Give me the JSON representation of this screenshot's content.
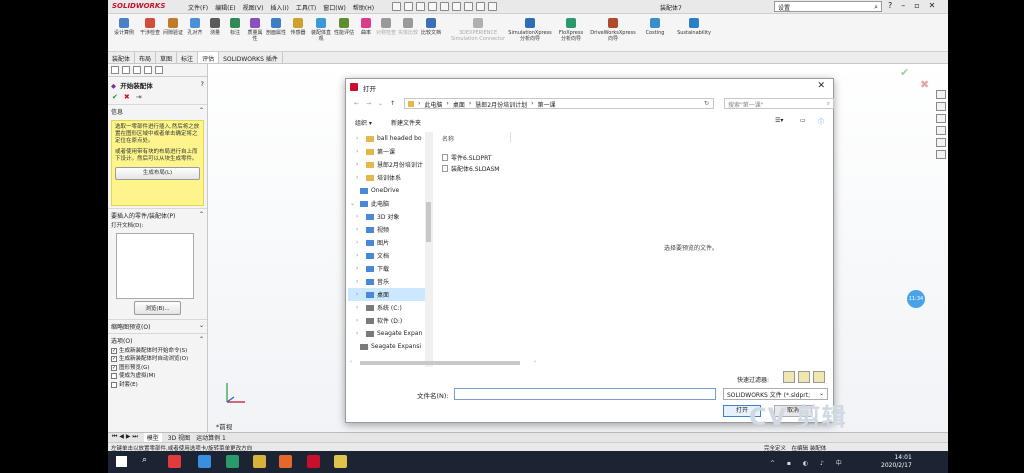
{
  "app": {
    "logo": "SOLIDWORKS",
    "menu": [
      "文件(F)",
      "编辑(E)",
      "视图(V)",
      "插入(I)",
      "工具(T)",
      "窗口(W)",
      "帮助(H)"
    ],
    "doc_title": "装配体7",
    "search_placeholder": "设置"
  },
  "ribbon": [
    {
      "label": "设计算例",
      "color": "#4a7fc9"
    },
    {
      "label": "干涉检查",
      "color": "#d24b3c"
    },
    {
      "label": "间隙验证",
      "color": "#c07a2a"
    },
    {
      "label": "孔对齐",
      "color": "#4d8fd6"
    },
    {
      "label": "测量",
      "color": "#5a5a5a"
    },
    {
      "label": "标注",
      "color": "#2e8b57"
    },
    {
      "label": "质量属性",
      "color": "#8c4fbf"
    },
    {
      "label": "剖面属性",
      "color": "#3d7ec4"
    },
    {
      "label": "传感器",
      "color": "#d0a02a"
    },
    {
      "label": "装配体直观",
      "color": "#3a9ad9"
    },
    {
      "label": "性能评估",
      "color": "#5c8f2e"
    },
    {
      "label": "曲率",
      "color": "#d83c8a"
    },
    {
      "label": "对称检查",
      "color": "#9a9a9a"
    },
    {
      "label": "实体比较",
      "color": "#9a9a9a"
    },
    {
      "label": "比较文档",
      "color": "#3b6fb8"
    },
    {
      "label": "3DEXPERIENCE Simulation Connector",
      "color": "#b0b0b0"
    },
    {
      "label": "SimulationXpress 分析向导",
      "color": "#2f6db5"
    },
    {
      "label": "FloXpress 分析向导",
      "color": "#2a9a6a"
    },
    {
      "label": "DriveWorksXpress 向导",
      "color": "#b04a2a"
    },
    {
      "label": "Costing",
      "color": "#3a8fc9"
    },
    {
      "label": "Sustainability",
      "color": "#2a7fc9"
    }
  ],
  "tabs": [
    "装配体",
    "布局",
    "草图",
    "标注",
    "评估",
    "SOLIDWORKS 插件"
  ],
  "tab_active": "评估",
  "pm": {
    "title": "开始装配体",
    "sections": {
      "info": "信息",
      "parts": "要插入的零件/装配体(P)",
      "thumbs": "缩略图预览(O)",
      "options": "选项(O)"
    },
    "info_text1": "选取一零部件进行插入,然后将之放置在图形区域中或者单击确定将之定位在原点处。",
    "info_text2": "或者使用带有块的布局进行自上而下设计。然后可以从块生成零件。",
    "layout_btn": "生成布局(L)",
    "open_doc": "打开文档(D):",
    "browse_btn": "浏览(B)...",
    "options": [
      {
        "label": "生成新装配体时开始命令(S)",
        "checked": true
      },
      {
        "label": "生成新装配体时自动浏览(O)",
        "checked": true
      },
      {
        "label": "图形预览(G)",
        "checked": true
      },
      {
        "label": "使成为虚拟(M)",
        "checked": false
      },
      {
        "label": "封套(E)",
        "checked": false
      }
    ]
  },
  "view_label": "*前视",
  "bottom_tabs": [
    "模型",
    "3D 视图",
    "运动算例 1"
  ],
  "bottom_active": "模型",
  "status": "左键单击以放置零部件,或者使用选项卡/旋转菜单更改方向",
  "status_right": "完全定义　在编辑 装配体",
  "dialog": {
    "title": "打开",
    "path": [
      "此电脑",
      "桌面",
      "慧郎2月份培训计划",
      "第一课"
    ],
    "search_placeholder": "搜索\"第一课\"",
    "organize": "组织 ▾",
    "new_folder": "新建文件夹",
    "tree": [
      {
        "label": "ball headed bo",
        "kind": "folder",
        "indent": 1
      },
      {
        "label": "第一课",
        "kind": "folder",
        "indent": 1
      },
      {
        "label": "慧郎2月份培训计",
        "kind": "folder",
        "indent": 1
      },
      {
        "label": "培训体系",
        "kind": "folder",
        "indent": 1
      },
      {
        "label": "OneDrive",
        "kind": "cloud",
        "indent": 0
      },
      {
        "label": "此电脑",
        "kind": "pc",
        "indent": 0
      },
      {
        "label": "3D 对象",
        "kind": "blue",
        "indent": 1
      },
      {
        "label": "视频",
        "kind": "blue",
        "indent": 1
      },
      {
        "label": "图片",
        "kind": "blue",
        "indent": 1
      },
      {
        "label": "文档",
        "kind": "blue",
        "indent": 1
      },
      {
        "label": "下载",
        "kind": "blue",
        "indent": 1
      },
      {
        "label": "音乐",
        "kind": "blue",
        "indent": 1
      },
      {
        "label": "桌面",
        "kind": "blue",
        "indent": 1,
        "selected": true
      },
      {
        "label": "系统 (C:)",
        "kind": "drive",
        "indent": 1
      },
      {
        "label": "软件 (D:)",
        "kind": "drive",
        "indent": 1
      },
      {
        "label": "Seagate Expan",
        "kind": "drive",
        "indent": 1
      },
      {
        "label": "Seagate Expansi",
        "kind": "drive",
        "indent": 0
      }
    ],
    "column_name": "名称",
    "files": [
      "零件6.SLDPRT",
      "装配体6.SLDASM"
    ],
    "preview_text": "选择要预览的文件。",
    "quick_filter": "快速过滤器:",
    "filename_label": "文件名(N):",
    "filename_value": "",
    "filetype": "SOLIDWORKS 文件 (*.sldprt;",
    "open_btn": "打开",
    "cancel_btn": "取消"
  },
  "clock": {
    "time": "14:01",
    "date": "2020/2/17"
  },
  "badge": "11:34",
  "watermark": "CV 剪辑"
}
